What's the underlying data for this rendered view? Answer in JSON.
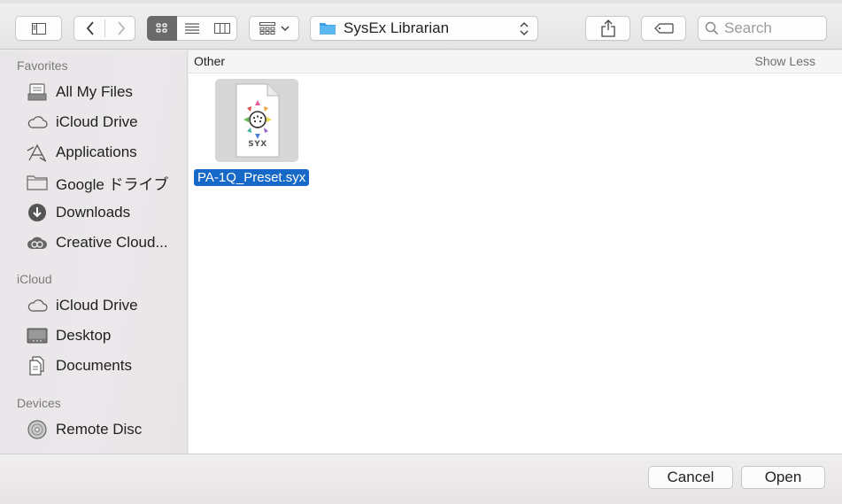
{
  "toolbar": {
    "location": "SysEx Librarian",
    "search_placeholder": "Search"
  },
  "sidebar": {
    "sections": [
      {
        "header": "Favorites",
        "items": [
          {
            "label": "All My Files",
            "icon": "all-files-icon"
          },
          {
            "label": "iCloud Drive",
            "icon": "cloud-icon"
          },
          {
            "label": "Applications",
            "icon": "applications-icon"
          },
          {
            "label": "Google ドライブ",
            "icon": "folder-icon"
          },
          {
            "label": "Downloads",
            "icon": "downloads-icon"
          },
          {
            "label": "Creative Cloud...",
            "icon": "creative-cloud-icon"
          }
        ]
      },
      {
        "header": "iCloud",
        "items": [
          {
            "label": "iCloud Drive",
            "icon": "cloud-icon"
          },
          {
            "label": "Desktop",
            "icon": "desktop-icon"
          },
          {
            "label": "Documents",
            "icon": "documents-icon"
          }
        ]
      },
      {
        "header": "Devices",
        "items": [
          {
            "label": "Remote Disc",
            "icon": "disc-icon"
          }
        ]
      }
    ]
  },
  "main": {
    "group_title": "Other",
    "show_less": "Show Less",
    "file": {
      "name": "PA-1Q_Preset.syx",
      "badge": "SYX",
      "icon": "syx-file-icon"
    }
  },
  "footer": {
    "cancel_label": "Cancel",
    "open_label": "Open"
  },
  "colors": {
    "selection": "#1769c8",
    "folder_accent": "#3da0e6",
    "grid_view_active": "#6a6a6a"
  }
}
